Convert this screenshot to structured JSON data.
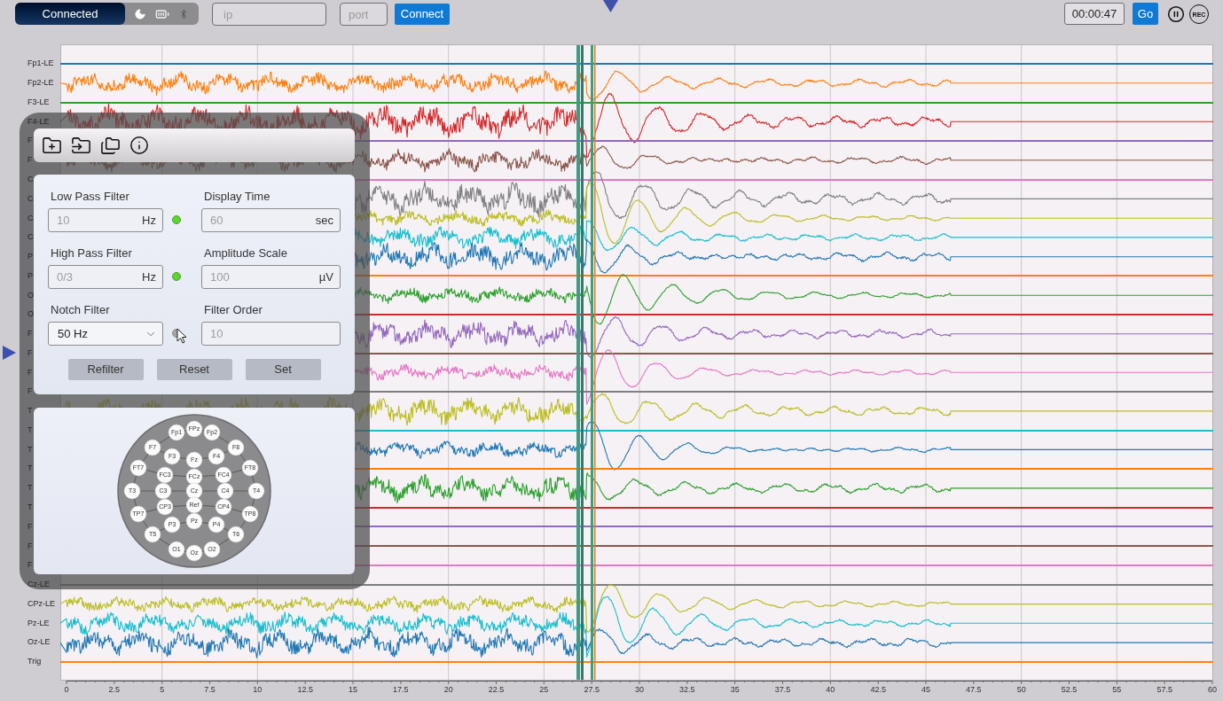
{
  "top_bar": {
    "connection_status": "Connected",
    "ip_field": {
      "placeholder": "ip"
    },
    "port_field": {
      "placeholder": "port"
    },
    "connect_button": "Connect",
    "elapsed_time": "00:00:47",
    "go_button": "Go",
    "record_button": "REC"
  },
  "channels": [
    {
      "label": "Fp1-LE",
      "color": "#1f77b4",
      "kind": "flat",
      "selected": false
    },
    {
      "label": "Fp2-LE",
      "color": "#ff7f0e",
      "kind": "signal",
      "selected": false
    },
    {
      "label": "F3-LE",
      "color": "#2ca02c",
      "kind": "flat",
      "selected": false
    },
    {
      "label": "F4-LE",
      "color": "#d62728",
      "kind": "signal",
      "selected": false
    },
    {
      "label": "F",
      "color": "#9467bd",
      "kind": "flat",
      "selected": false
    },
    {
      "label": "F",
      "color": "#8c564b",
      "kind": "signal",
      "selected": false
    },
    {
      "label": "C",
      "color": "#e377c2",
      "kind": "flat",
      "selected": false
    },
    {
      "label": "C",
      "color": "#7f7f7f",
      "kind": "signal",
      "selected": false
    },
    {
      "label": "C",
      "color": "#bcbd22",
      "kind": "signal",
      "selected": false
    },
    {
      "label": "C",
      "color": "#17becf",
      "kind": "signal",
      "selected": false
    },
    {
      "label": "P",
      "color": "#1f77b4",
      "kind": "signal",
      "selected": false
    },
    {
      "label": "P",
      "color": "#ff7f0e",
      "kind": "flat",
      "selected": false
    },
    {
      "label": "O",
      "color": "#2ca02c",
      "kind": "signal",
      "selected": false
    },
    {
      "label": "O",
      "color": "#d62728",
      "kind": "flat",
      "selected": false
    },
    {
      "label": "F",
      "color": "#9467bd",
      "kind": "signal",
      "selected": false
    },
    {
      "label": "F",
      "color": "#8c564b",
      "kind": "flat",
      "selected": true
    },
    {
      "label": "F",
      "color": "#e377c2",
      "kind": "signal",
      "selected": false
    },
    {
      "label": "F",
      "color": "#7f7f7f",
      "kind": "flat",
      "selected": false
    },
    {
      "label": "T",
      "color": "#bcbd22",
      "kind": "signal",
      "selected": false
    },
    {
      "label": "T",
      "color": "#17becf",
      "kind": "flat",
      "selected": false
    },
    {
      "label": "T",
      "color": "#1f77b4",
      "kind": "signal",
      "selected": false
    },
    {
      "label": "T",
      "color": "#ff7f0e",
      "kind": "flat",
      "selected": false
    },
    {
      "label": "T",
      "color": "#2ca02c",
      "kind": "signal",
      "selected": false
    },
    {
      "label": "T",
      "color": "#d62728",
      "kind": "flat",
      "selected": false
    },
    {
      "label": "F",
      "color": "#9467bd",
      "kind": "flat",
      "selected": false
    },
    {
      "label": "F",
      "color": "#8c564b",
      "kind": "flat",
      "selected": false
    },
    {
      "label": "F",
      "color": "#e377c2",
      "kind": "flat",
      "selected": false
    },
    {
      "label": "Cz-LE",
      "color": "#7f7f7f",
      "kind": "flat",
      "selected": false
    },
    {
      "label": "CPz-LE",
      "color": "#bcbd22",
      "kind": "signal",
      "selected": false
    },
    {
      "label": "Pz-LE",
      "color": "#17becf",
      "kind": "signal",
      "selected": false
    },
    {
      "label": "Oz-LE",
      "color": "#1f77b4",
      "kind": "signal",
      "selected": false
    },
    {
      "label": "Trig",
      "color": "#ff7f0e",
      "kind": "flat",
      "selected": false
    }
  ],
  "x_axis": {
    "ticks": [
      "0",
      "2.5",
      "5",
      "7.5",
      "10",
      "12.5",
      "15",
      "17.5",
      "20",
      "22.5",
      "25",
      "27.5",
      "30",
      "32.5",
      "35",
      "37.5",
      "40",
      "42.5",
      "45",
      "47.5",
      "50",
      "52.5",
      "55",
      "57.5",
      "60"
    ]
  },
  "settings": {
    "fields": [
      {
        "label": "Low Pass Filter",
        "kind": "input",
        "placeholder": "10",
        "unit": "Hz",
        "on": true
      },
      {
        "label": "Display Time",
        "kind": "input",
        "placeholder": "60",
        "unit": "sec"
      },
      {
        "label": "High Pass Filter",
        "kind": "input",
        "placeholder": "0/3",
        "unit": "Hz",
        "on": true
      },
      {
        "label": "Amplitude Scale",
        "kind": "input",
        "placeholder": "100",
        "unit": "µV"
      },
      {
        "label": "Notch Filter",
        "kind": "select",
        "value": "50 Hz",
        "on": false
      },
      {
        "label": "Filter Order",
        "kind": "input",
        "placeholder": "10"
      }
    ],
    "buttons": [
      "Refilter",
      "Reset",
      "Set"
    ]
  },
  "electrode_map": {
    "electrodes": [
      "Fp1",
      "FPz",
      "Fp2",
      "F7",
      "F3",
      "Fz",
      "F4",
      "F8",
      "FT7",
      "FC3",
      "FCz",
      "FC4",
      "FT8",
      "T3",
      "C3",
      "Cz",
      "C4",
      "T4",
      "TP7",
      "CP3",
      "Ref",
      "CP4",
      "TP8",
      "T5",
      "P3",
      "Pz",
      "P4",
      "T6",
      "O1",
      "Oz",
      "O2"
    ]
  }
}
